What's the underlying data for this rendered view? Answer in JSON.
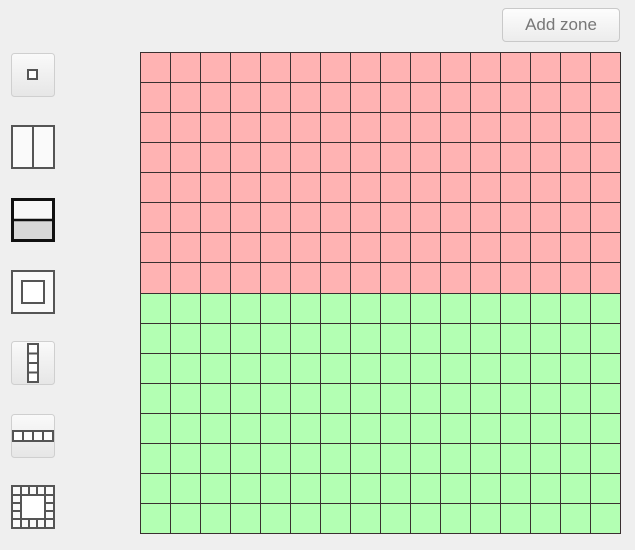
{
  "toolbar": {
    "add_zone_label": "Add zone"
  },
  "layout_tools": [
    {
      "name": "layout-single-zone-tool",
      "icon": "small-square-icon",
      "active": false
    },
    {
      "name": "layout-vertical-split-tool",
      "icon": "columns-icon",
      "active": false
    },
    {
      "name": "layout-horizontal-split-tool",
      "icon": "rows-icon",
      "active": true
    },
    {
      "name": "layout-inset-tool",
      "icon": "inset-square-icon",
      "active": false
    },
    {
      "name": "layout-vertical-strip-tool",
      "icon": "vertical-strip-icon",
      "active": false
    },
    {
      "name": "layout-horizontal-strip-tool",
      "icon": "horizontal-strip-icon",
      "active": false
    },
    {
      "name": "layout-ring-tool",
      "icon": "ring-grid-icon",
      "active": false
    }
  ],
  "grid": {
    "columns": 16,
    "rows": 16,
    "zones": [
      {
        "name": "zone-top",
        "color": "#ffb3b3",
        "row_start": 0,
        "row_end": 8
      },
      {
        "name": "zone-bottom",
        "color": "#b3ffb3",
        "row_start": 8,
        "row_end": 16
      }
    ],
    "line_color": "#3a3030"
  }
}
